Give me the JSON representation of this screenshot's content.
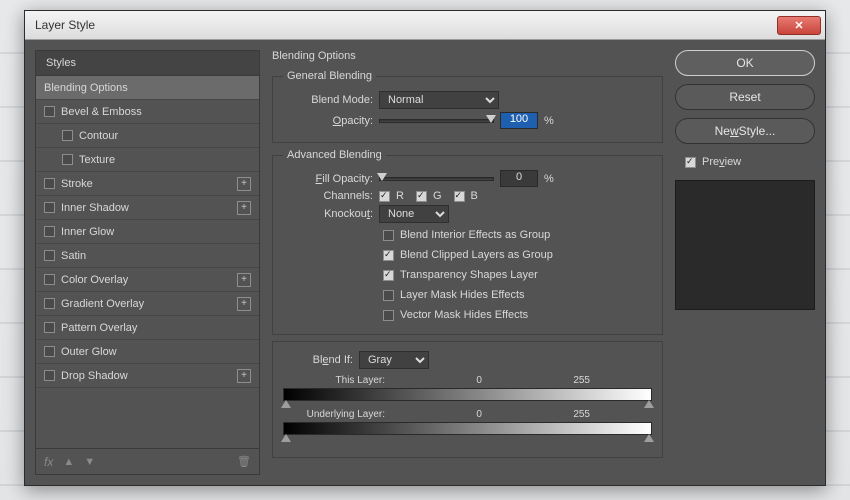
{
  "window": {
    "title": "Layer Style"
  },
  "sidebar": {
    "header": "Styles",
    "items": [
      {
        "label": "Blending Options",
        "checkbox": false,
        "selected": true,
        "plus": false,
        "sub": false
      },
      {
        "label": "Bevel & Emboss",
        "checkbox": true,
        "selected": false,
        "plus": false,
        "sub": false
      },
      {
        "label": "Contour",
        "checkbox": true,
        "selected": false,
        "plus": false,
        "sub": true
      },
      {
        "label": "Texture",
        "checkbox": true,
        "selected": false,
        "plus": false,
        "sub": true
      },
      {
        "label": "Stroke",
        "checkbox": true,
        "selected": false,
        "plus": true,
        "sub": false
      },
      {
        "label": "Inner Shadow",
        "checkbox": true,
        "selected": false,
        "plus": true,
        "sub": false
      },
      {
        "label": "Inner Glow",
        "checkbox": true,
        "selected": false,
        "plus": false,
        "sub": false
      },
      {
        "label": "Satin",
        "checkbox": true,
        "selected": false,
        "plus": false,
        "sub": false
      },
      {
        "label": "Color Overlay",
        "checkbox": true,
        "selected": false,
        "plus": true,
        "sub": false
      },
      {
        "label": "Gradient Overlay",
        "checkbox": true,
        "selected": false,
        "plus": true,
        "sub": false
      },
      {
        "label": "Pattern Overlay",
        "checkbox": true,
        "selected": false,
        "plus": false,
        "sub": false
      },
      {
        "label": "Outer Glow",
        "checkbox": true,
        "selected": false,
        "plus": false,
        "sub": false
      },
      {
        "label": "Drop Shadow",
        "checkbox": true,
        "selected": false,
        "plus": true,
        "sub": false
      }
    ],
    "footer": {
      "fx": "fx"
    }
  },
  "options": {
    "heading": "Blending Options",
    "general": {
      "legend": "General Blending",
      "blend_mode_label": "Blend Mode:",
      "blend_mode_value": "Normal",
      "opacity_label": "Opacity:",
      "opacity_value": "100",
      "opacity_unit": "%"
    },
    "advanced": {
      "legend": "Advanced Blending",
      "fill_opacity_label": "Fill Opacity:",
      "fill_opacity_value": "0",
      "fill_opacity_unit": "%",
      "channels_label": "Channels:",
      "channel_r": "R",
      "channel_g": "G",
      "channel_b": "B",
      "knockout_label": "Knockout:",
      "knockout_value": "None",
      "c1": "Blend Interior Effects as Group",
      "c2": "Blend Clipped Layers as Group",
      "c3": "Transparency Shapes Layer",
      "c4": "Layer Mask Hides Effects",
      "c5": "Vector Mask Hides Effects"
    },
    "blendif": {
      "label": "Blend If:",
      "value": "Gray",
      "this_layer_label": "This Layer:",
      "this_min": "0",
      "this_max": "255",
      "under_label": "Underlying Layer:",
      "under_min": "0",
      "under_max": "255"
    }
  },
  "right": {
    "ok": "OK",
    "reset": "Reset",
    "new_style": "New Style...",
    "preview": "Preview"
  }
}
